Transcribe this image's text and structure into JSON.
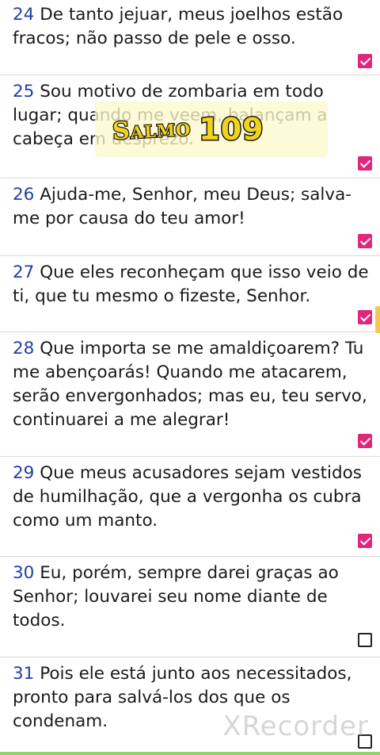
{
  "verses": [
    {
      "num": "24",
      "text": "De tanto jejuar, meus joelhos estão fracos; não passo de pele e osso.",
      "checked": true
    },
    {
      "num": "25",
      "text": "Sou motivo de zombaria em todo lugar; quando me veem, balançam a cabeça em desprezo.",
      "checked": true
    },
    {
      "num": "26",
      "text": "Ajuda-me, Senhor, meu Deus; salva-me por causa do teu amor!",
      "checked": true
    },
    {
      "num": "27",
      "text": "Que eles reconheçam que isso veio de ti, que tu mesmo o fizeste, Senhor.",
      "checked": true
    },
    {
      "num": "28",
      "text": "Que importa se me amaldiçoarem? Tu me abençoarás! Quando me atacarem, serão envergonhados; mas eu, teu servo, continuarei a me alegrar!",
      "checked": true
    },
    {
      "num": "29",
      "text": "Que meus acusadores sejam vestidos de humilhação, que a vergonha os cubra como um manto.",
      "checked": true
    },
    {
      "num": "30",
      "text": "Eu, porém, sempre darei graças ao Senhor; louvarei seu nome diante de todos.",
      "checked": false
    },
    {
      "num": "31",
      "text": "Pois ele está junto aos necessitados, pronto para salvá-los dos que os condenam.",
      "checked": false
    }
  ],
  "overlay": {
    "word": "Salmo",
    "number": "109"
  },
  "watermark": "XRecorder",
  "colors": {
    "verse_number": "#1f3fa8",
    "checkbox_checked": "#e0277a",
    "divider": "#d9d9d9",
    "overlay_text": "#f1d21c"
  }
}
